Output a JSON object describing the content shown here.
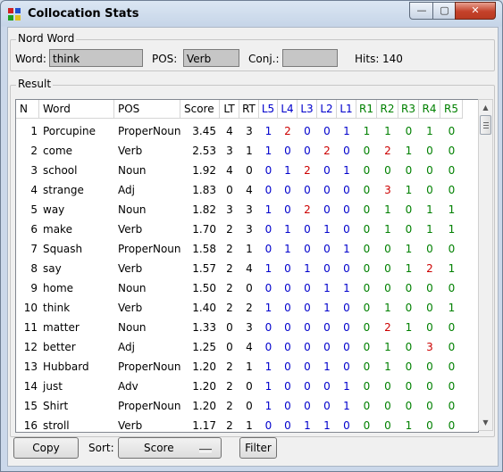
{
  "window": {
    "title": "Collocation Stats"
  },
  "title_buttons": {
    "minimize": "—",
    "maximize": "▢",
    "close": "✕"
  },
  "word_group": {
    "label": "Nord Word",
    "word_label": "Word:",
    "word_value": "think",
    "pos_label": "POS:",
    "pos_value": "Verb",
    "conj_label": "Conj.:",
    "conj_value": "",
    "hits_label": "Hits:",
    "hits_value": "140"
  },
  "result": {
    "label": "Result",
    "columns": [
      "N",
      "Word",
      "POS",
      "Score",
      "LT",
      "RT",
      "L5",
      "L4",
      "L3",
      "L2",
      "L1",
      "R1",
      "R2",
      "R3",
      "R4",
      "R5"
    ],
    "rows": [
      [
        "1",
        "Porcupine",
        "ProperNoun",
        "3.45",
        "4",
        "3",
        "1",
        "2",
        "0",
        "0",
        "1",
        "1",
        "1",
        "0",
        "1",
        "0"
      ],
      [
        "2",
        "come",
        "Verb",
        "2.53",
        "3",
        "1",
        "1",
        "0",
        "0",
        "2",
        "0",
        "0",
        "2",
        "1",
        "0",
        "0"
      ],
      [
        "3",
        "school",
        "Noun",
        "1.92",
        "4",
        "0",
        "0",
        "1",
        "2",
        "0",
        "1",
        "0",
        "0",
        "0",
        "0",
        "0"
      ],
      [
        "4",
        "strange",
        "Adj",
        "1.83",
        "0",
        "4",
        "0",
        "0",
        "0",
        "0",
        "0",
        "0",
        "3",
        "1",
        "0",
        "0"
      ],
      [
        "5",
        "way",
        "Noun",
        "1.82",
        "3",
        "3",
        "1",
        "0",
        "2",
        "0",
        "0",
        "0",
        "1",
        "0",
        "1",
        "1"
      ],
      [
        "6",
        "make",
        "Verb",
        "1.70",
        "2",
        "3",
        "0",
        "1",
        "0",
        "1",
        "0",
        "0",
        "1",
        "0",
        "1",
        "1"
      ],
      [
        "7",
        "Squash",
        "ProperNoun",
        "1.58",
        "2",
        "1",
        "0",
        "1",
        "0",
        "0",
        "1",
        "0",
        "0",
        "1",
        "0",
        "0"
      ],
      [
        "8",
        "say",
        "Verb",
        "1.57",
        "2",
        "4",
        "1",
        "0",
        "1",
        "0",
        "0",
        "0",
        "0",
        "1",
        "2",
        "1"
      ],
      [
        "9",
        "home",
        "Noun",
        "1.50",
        "2",
        "0",
        "0",
        "0",
        "0",
        "1",
        "1",
        "0",
        "0",
        "0",
        "0",
        "0"
      ],
      [
        "10",
        "think",
        "Verb",
        "1.40",
        "2",
        "2",
        "1",
        "0",
        "0",
        "1",
        "0",
        "0",
        "1",
        "0",
        "0",
        "1"
      ],
      [
        "11",
        "matter",
        "Noun",
        "1.33",
        "0",
        "3",
        "0",
        "0",
        "0",
        "0",
        "0",
        "0",
        "2",
        "1",
        "0",
        "0"
      ],
      [
        "12",
        "better",
        "Adj",
        "1.25",
        "0",
        "4",
        "0",
        "0",
        "0",
        "0",
        "0",
        "0",
        "1",
        "0",
        "3",
        "0"
      ],
      [
        "13",
        "Hubbard",
        "ProperNoun",
        "1.20",
        "2",
        "1",
        "1",
        "0",
        "0",
        "1",
        "0",
        "0",
        "1",
        "0",
        "0",
        "0"
      ],
      [
        "14",
        "just",
        "Adv",
        "1.20",
        "2",
        "0",
        "1",
        "0",
        "0",
        "0",
        "1",
        "0",
        "0",
        "0",
        "0",
        "0"
      ],
      [
        "15",
        "Shirt",
        "ProperNoun",
        "1.20",
        "2",
        "0",
        "1",
        "0",
        "0",
        "0",
        "1",
        "0",
        "0",
        "0",
        "0",
        "0"
      ],
      [
        "16",
        "stroll",
        "Verb",
        "1.17",
        "2",
        "1",
        "0",
        "0",
        "1",
        "1",
        "0",
        "0",
        "0",
        "1",
        "0",
        "0"
      ]
    ]
  },
  "bottom": {
    "copy_label": "Copy",
    "sort_label": "Sort:",
    "sort_value": "Score",
    "filter_label": "Filter"
  },
  "colors": {
    "left": "#0000cc",
    "right": "#008000",
    "highlight": "#cc0000",
    "zero_left": "#0000cc"
  }
}
